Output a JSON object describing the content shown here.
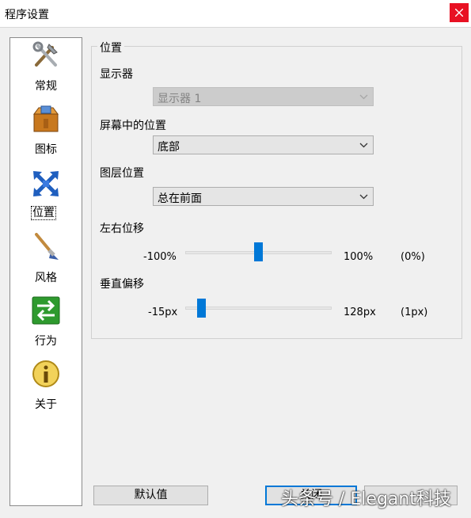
{
  "window": {
    "title": "程序设置"
  },
  "sidebar": {
    "items": [
      {
        "label": "常规",
        "icon": "tools-icon"
      },
      {
        "label": "图标",
        "icon": "box-icon"
      },
      {
        "label": "位置",
        "icon": "move-arrows-icon"
      },
      {
        "label": "风格",
        "icon": "brush-icon"
      },
      {
        "label": "行为",
        "icon": "exchange-arrows-icon"
      },
      {
        "label": "关于",
        "icon": "info-icon"
      }
    ]
  },
  "position": {
    "group_title": "位置",
    "monitor_label": "显示器",
    "monitor_value": "显示器 1",
    "screen_position_label": "屏幕中的位置",
    "screen_position_value": "底部",
    "layer_label": "图层位置",
    "layer_value": "总在前面",
    "h_offset_label": "左右位移",
    "h_offset_min": "-100%",
    "h_offset_max": "100%",
    "h_offset_current": "(0%)",
    "h_offset_fraction": 0.5,
    "v_offset_label": "垂直偏移",
    "v_offset_min": "-15px",
    "v_offset_max": "128px",
    "v_offset_current": "(1px)",
    "v_offset_fraction": 0.112
  },
  "buttons": {
    "defaults": "默认值",
    "close": "关闭"
  },
  "watermark": "头条号 / Elegant科技",
  "colors": {
    "accent": "#0078d7",
    "close": "#e81123"
  }
}
